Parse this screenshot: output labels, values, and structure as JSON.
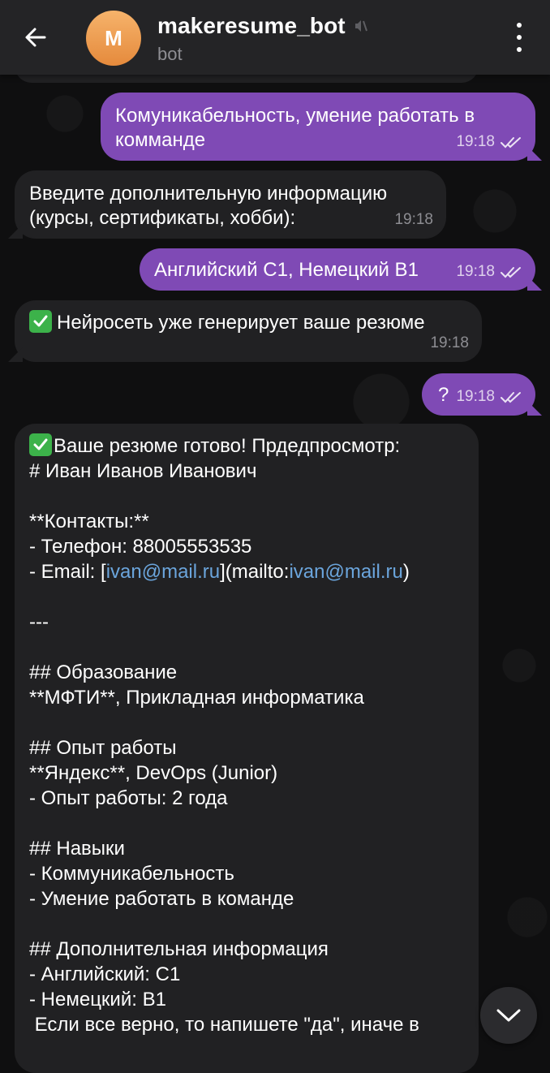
{
  "header": {
    "avatar_letter": "M",
    "title": "makeresume_bot",
    "subtitle": "bot"
  },
  "messages": [
    {
      "from": "user",
      "text": "Комуникабельность, умение работать в комманде",
      "time": "19:18"
    },
    {
      "from": "bot",
      "text": "Введите дополнительную информацию (курсы, сертификаты, хобби):",
      "time": "19:18"
    },
    {
      "from": "user",
      "text": "Английский С1, Немецкий В1",
      "time": "19:18"
    },
    {
      "from": "bot",
      "text": "Нейросеть уже генерирует ваше резюме",
      "time": "19:18"
    },
    {
      "from": "user",
      "text": "?",
      "time": "19:18"
    }
  ],
  "resume": {
    "head": "Ваше резюме готово! Прдедпросмотр:",
    "name_line": "# Иван Иванов Иванович",
    "contacts_heading": "**Контакты:**",
    "phone": "- Телефон: 88005553535",
    "email_prefix": "- Email: [",
    "email_link": "ivan@mail.ru",
    "email_mid": "](mailto:",
    "email_link2": "ivan@mail.ru",
    "email_suffix": ")",
    "divider": "---",
    "education_heading": "## Образование",
    "education_line": "**МФТИ**, Прикладная информатика",
    "experience_heading": "## Опыт работы",
    "experience_line1": "**Яндекс**, DevOps (Junior)",
    "experience_line2": "- Опыт работы: 2 года",
    "skills_heading": "## Навыки",
    "skills_line1": "- Коммуникабельность",
    "skills_line2": "- Умение работать в команде",
    "extra_heading": "## Дополнительная информация",
    "extra_line1": "- Английский: С1",
    "extra_line2": "- Немецкий: В1",
    "confirm_line": " Если все верно, то напишете \"да\", иначе в"
  },
  "colors": {
    "outgoing_bubble": "#7f4ab5",
    "incoming_bubble": "#212123",
    "header": "#242426",
    "link": "#6ba5dc",
    "check_emoji": "#3cb24a"
  },
  "icons": [
    "back-arrow-icon",
    "muted-speaker-icon",
    "more-vert-icon",
    "double-check-icon",
    "check-mark-emoji-icon",
    "chevron-down-icon"
  ]
}
